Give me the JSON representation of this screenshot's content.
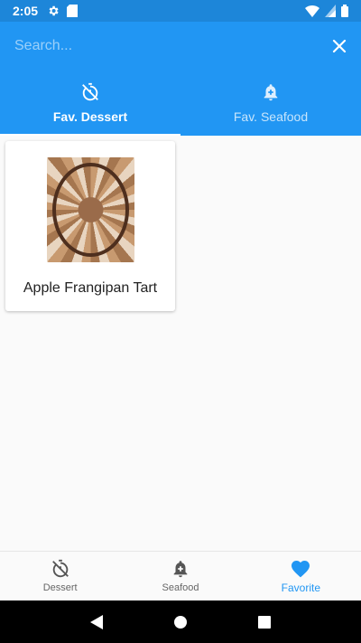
{
  "status_bar": {
    "time": "2:05",
    "icons": [
      "gear-icon",
      "sd-card-icon",
      "wifi-icon",
      "signal-icon",
      "battery-icon"
    ]
  },
  "search": {
    "placeholder": "Search..."
  },
  "tabs": [
    {
      "label": "Fav. Dessert",
      "icon": "timer-off-icon",
      "active": true
    },
    {
      "label": "Fav. Seafood",
      "icon": "bell-plus-icon",
      "active": false
    }
  ],
  "items": [
    {
      "title": "Apple Frangipan Tart"
    }
  ],
  "bottom_nav": [
    {
      "label": "Dessert",
      "icon": "timer-off-icon",
      "active": false
    },
    {
      "label": "Seafood",
      "icon": "bell-plus-icon",
      "active": false
    },
    {
      "label": "Favorite",
      "icon": "heart-icon",
      "active": true
    }
  ],
  "colors": {
    "primary": "#2196f3",
    "status_bar": "#1d86d9",
    "nav_bar": "#000000"
  }
}
